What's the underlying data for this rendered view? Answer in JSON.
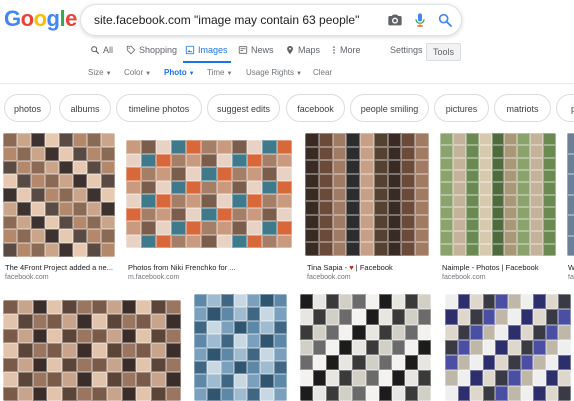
{
  "logo": {
    "letters": [
      "G",
      "o",
      "o",
      "g",
      "l",
      "e"
    ],
    "colors": [
      "#4285f4",
      "#ea4335",
      "#fbbc05",
      "#4285f4",
      "#34a853",
      "#ea4335"
    ]
  },
  "search": {
    "query": "site.facebook.com \"image may contain 63 people\"",
    "icons": [
      "camera-icon",
      "microphone-icon",
      "search-icon"
    ]
  },
  "nav": {
    "tabs": [
      {
        "label": "All",
        "icon": "search-icon"
      },
      {
        "label": "Shopping",
        "icon": "tag-icon"
      },
      {
        "label": "Images",
        "icon": "image-icon",
        "active": true
      },
      {
        "label": "News",
        "icon": "news-icon"
      },
      {
        "label": "Maps",
        "icon": "map-pin-icon"
      },
      {
        "label": "More",
        "icon": "more-icon"
      }
    ],
    "settings": "Settings",
    "tools": "Tools"
  },
  "filters": [
    {
      "label": "Size"
    },
    {
      "label": "Color"
    },
    {
      "label": "Photo",
      "active": true
    },
    {
      "label": "Time"
    },
    {
      "label": "Usage Rights"
    },
    {
      "label": "Clear"
    }
  ],
  "chips": [
    "photos",
    "albums",
    "timeline photos",
    "suggest edits",
    "facebook",
    "people smiling",
    "pictures",
    "matriots",
    "pe"
  ],
  "results": [
    {
      "title": "The 4Front Project added a ne...",
      "source": "facebook.com",
      "palette": [
        "#8a6a55",
        "#caa58a",
        "#3d3230",
        "#e6c9b0",
        "#5a4a44",
        "#b4886a"
      ]
    },
    {
      "title": "Photos from Niki Frenchko for ...",
      "source": "m.facebook.com",
      "palette": [
        "#c99a7d",
        "#7b5d4c",
        "#e7d2c3",
        "#3e7a8c",
        "#d8673a",
        "#a57e68"
      ]
    },
    {
      "title_prefix": "Tina Sapia - ",
      "title_suffix": " | Facebook",
      "source": "facebook.com",
      "palette": [
        "#3a2a24",
        "#6b4a3a",
        "#a07a62",
        "#2d2d2d",
        "#c79f86",
        "#54412f"
      ]
    },
    {
      "title": "Naimple - Photos | Facebook",
      "source": "facebook.com",
      "palette": [
        "#8aa36c",
        "#c4b39a",
        "#6b8a52",
        "#d7c9ad",
        "#4f6b3e",
        "#a99878"
      ]
    },
    {
      "title": "W",
      "source": "fa",
      "palette": [
        "#6c7f96",
        "#b9c4d0"
      ]
    },
    {
      "palette": [
        "#7a5a48",
        "#c8a48c",
        "#3b2e2a",
        "#e2c4ac",
        "#5b4538",
        "#9a7660"
      ]
    },
    {
      "palette": [
        "#5d88a8",
        "#9fbbd0",
        "#3f6783",
        "#c7d8e3",
        "#7aa0bd",
        "#2f5570"
      ]
    },
    {
      "palette": [
        "#1c1c1c",
        "#e8e6e1",
        "#3a3a3a",
        "#d2cfc7",
        "#6b6b6b",
        "#f4f2ee"
      ]
    },
    {
      "palette": [
        "#efefef",
        "#2c2f6b",
        "#ddd7cc",
        "#3a3a44",
        "#4b4fa3",
        "#bfb8a8"
      ]
    }
  ]
}
